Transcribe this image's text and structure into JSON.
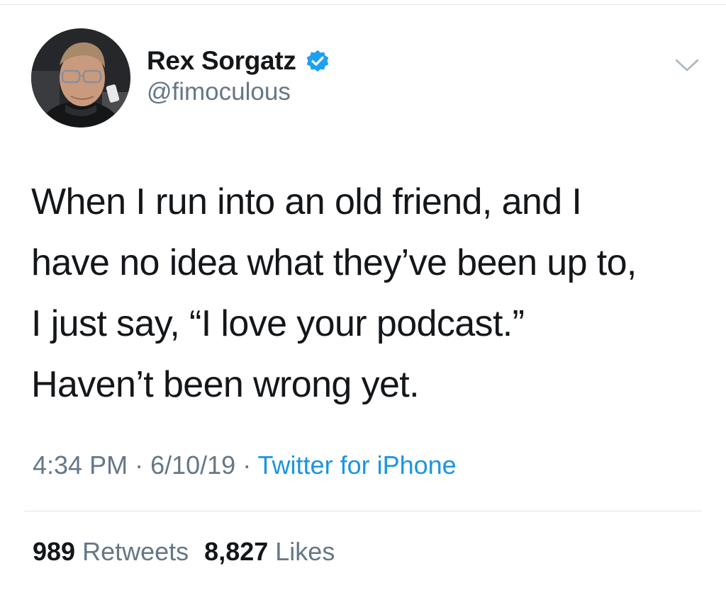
{
  "user": {
    "display_name": "Rex Sorgatz",
    "handle": "@fimoculous",
    "verified": true
  },
  "tweet": {
    "lines": [
      "When I run into an old friend, and I",
      "have no idea what they’ve been up to,",
      "I just say, “I love your podcast.”",
      "Haven’t been wrong yet."
    ]
  },
  "meta": {
    "time": "4:34 PM",
    "sep1": " · ",
    "date": "6/10/19",
    "sep2": " · ",
    "source": "Twitter for iPhone"
  },
  "stats": {
    "retweets_count": "989",
    "retweets_label": "Retweets",
    "likes_count": "8,827",
    "likes_label": "Likes"
  },
  "icons": {
    "verified": "verified-badge-icon",
    "menu": "chevron-down-icon"
  },
  "colors": {
    "text": "#14171a",
    "secondary": "#657786",
    "link": "#1b95e0",
    "verified": "#1da1f2"
  }
}
